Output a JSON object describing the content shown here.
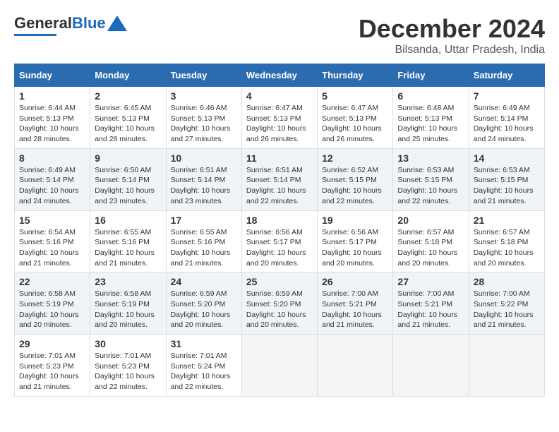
{
  "header": {
    "logo_text_general": "General",
    "logo_text_blue": "Blue",
    "month": "December 2024",
    "location": "Bilsanda, Uttar Pradesh, India"
  },
  "calendar": {
    "days_of_week": [
      "Sunday",
      "Monday",
      "Tuesday",
      "Wednesday",
      "Thursday",
      "Friday",
      "Saturday"
    ],
    "weeks": [
      [
        {
          "day": "",
          "empty": true
        },
        {
          "day": "",
          "empty": true
        },
        {
          "day": "",
          "empty": true
        },
        {
          "day": "",
          "empty": true
        },
        {
          "day": "",
          "empty": true
        },
        {
          "day": "",
          "empty": true
        },
        {
          "day": "",
          "empty": true
        }
      ],
      [
        {
          "day": "1",
          "sunrise": "6:44 AM",
          "sunset": "5:13 PM",
          "daylight": "10 hours and 28 minutes."
        },
        {
          "day": "2",
          "sunrise": "6:45 AM",
          "sunset": "5:13 PM",
          "daylight": "10 hours and 28 minutes."
        },
        {
          "day": "3",
          "sunrise": "6:46 AM",
          "sunset": "5:13 PM",
          "daylight": "10 hours and 27 minutes."
        },
        {
          "day": "4",
          "sunrise": "6:47 AM",
          "sunset": "5:13 PM",
          "daylight": "10 hours and 26 minutes."
        },
        {
          "day": "5",
          "sunrise": "6:47 AM",
          "sunset": "5:13 PM",
          "daylight": "10 hours and 26 minutes."
        },
        {
          "day": "6",
          "sunrise": "6:48 AM",
          "sunset": "5:13 PM",
          "daylight": "10 hours and 25 minutes."
        },
        {
          "day": "7",
          "sunrise": "6:49 AM",
          "sunset": "5:14 PM",
          "daylight": "10 hours and 24 minutes."
        }
      ],
      [
        {
          "day": "8",
          "sunrise": "6:49 AM",
          "sunset": "5:14 PM",
          "daylight": "10 hours and 24 minutes."
        },
        {
          "day": "9",
          "sunrise": "6:50 AM",
          "sunset": "5:14 PM",
          "daylight": "10 hours and 23 minutes."
        },
        {
          "day": "10",
          "sunrise": "6:51 AM",
          "sunset": "5:14 PM",
          "daylight": "10 hours and 23 minutes."
        },
        {
          "day": "11",
          "sunrise": "6:51 AM",
          "sunset": "5:14 PM",
          "daylight": "10 hours and 22 minutes."
        },
        {
          "day": "12",
          "sunrise": "6:52 AM",
          "sunset": "5:15 PM",
          "daylight": "10 hours and 22 minutes."
        },
        {
          "day": "13",
          "sunrise": "6:53 AM",
          "sunset": "5:15 PM",
          "daylight": "10 hours and 22 minutes."
        },
        {
          "day": "14",
          "sunrise": "6:53 AM",
          "sunset": "5:15 PM",
          "daylight": "10 hours and 21 minutes."
        }
      ],
      [
        {
          "day": "15",
          "sunrise": "6:54 AM",
          "sunset": "5:16 PM",
          "daylight": "10 hours and 21 minutes."
        },
        {
          "day": "16",
          "sunrise": "6:55 AM",
          "sunset": "5:16 PM",
          "daylight": "10 hours and 21 minutes."
        },
        {
          "day": "17",
          "sunrise": "6:55 AM",
          "sunset": "5:16 PM",
          "daylight": "10 hours and 21 minutes."
        },
        {
          "day": "18",
          "sunrise": "6:56 AM",
          "sunset": "5:17 PM",
          "daylight": "10 hours and 20 minutes."
        },
        {
          "day": "19",
          "sunrise": "6:56 AM",
          "sunset": "5:17 PM",
          "daylight": "10 hours and 20 minutes."
        },
        {
          "day": "20",
          "sunrise": "6:57 AM",
          "sunset": "5:18 PM",
          "daylight": "10 hours and 20 minutes."
        },
        {
          "day": "21",
          "sunrise": "6:57 AM",
          "sunset": "5:18 PM",
          "daylight": "10 hours and 20 minutes."
        }
      ],
      [
        {
          "day": "22",
          "sunrise": "6:58 AM",
          "sunset": "5:19 PM",
          "daylight": "10 hours and 20 minutes."
        },
        {
          "day": "23",
          "sunrise": "6:58 AM",
          "sunset": "5:19 PM",
          "daylight": "10 hours and 20 minutes."
        },
        {
          "day": "24",
          "sunrise": "6:59 AM",
          "sunset": "5:20 PM",
          "daylight": "10 hours and 20 minutes."
        },
        {
          "day": "25",
          "sunrise": "6:59 AM",
          "sunset": "5:20 PM",
          "daylight": "10 hours and 20 minutes."
        },
        {
          "day": "26",
          "sunrise": "7:00 AM",
          "sunset": "5:21 PM",
          "daylight": "10 hours and 21 minutes."
        },
        {
          "day": "27",
          "sunrise": "7:00 AM",
          "sunset": "5:21 PM",
          "daylight": "10 hours and 21 minutes."
        },
        {
          "day": "28",
          "sunrise": "7:00 AM",
          "sunset": "5:22 PM",
          "daylight": "10 hours and 21 minutes."
        }
      ],
      [
        {
          "day": "29",
          "sunrise": "7:01 AM",
          "sunset": "5:23 PM",
          "daylight": "10 hours and 21 minutes."
        },
        {
          "day": "30",
          "sunrise": "7:01 AM",
          "sunset": "5:23 PM",
          "daylight": "10 hours and 22 minutes."
        },
        {
          "day": "31",
          "sunrise": "7:01 AM",
          "sunset": "5:24 PM",
          "daylight": "10 hours and 22 minutes."
        },
        {
          "day": "",
          "empty": true
        },
        {
          "day": "",
          "empty": true
        },
        {
          "day": "",
          "empty": true
        },
        {
          "day": "",
          "empty": true
        }
      ]
    ]
  }
}
